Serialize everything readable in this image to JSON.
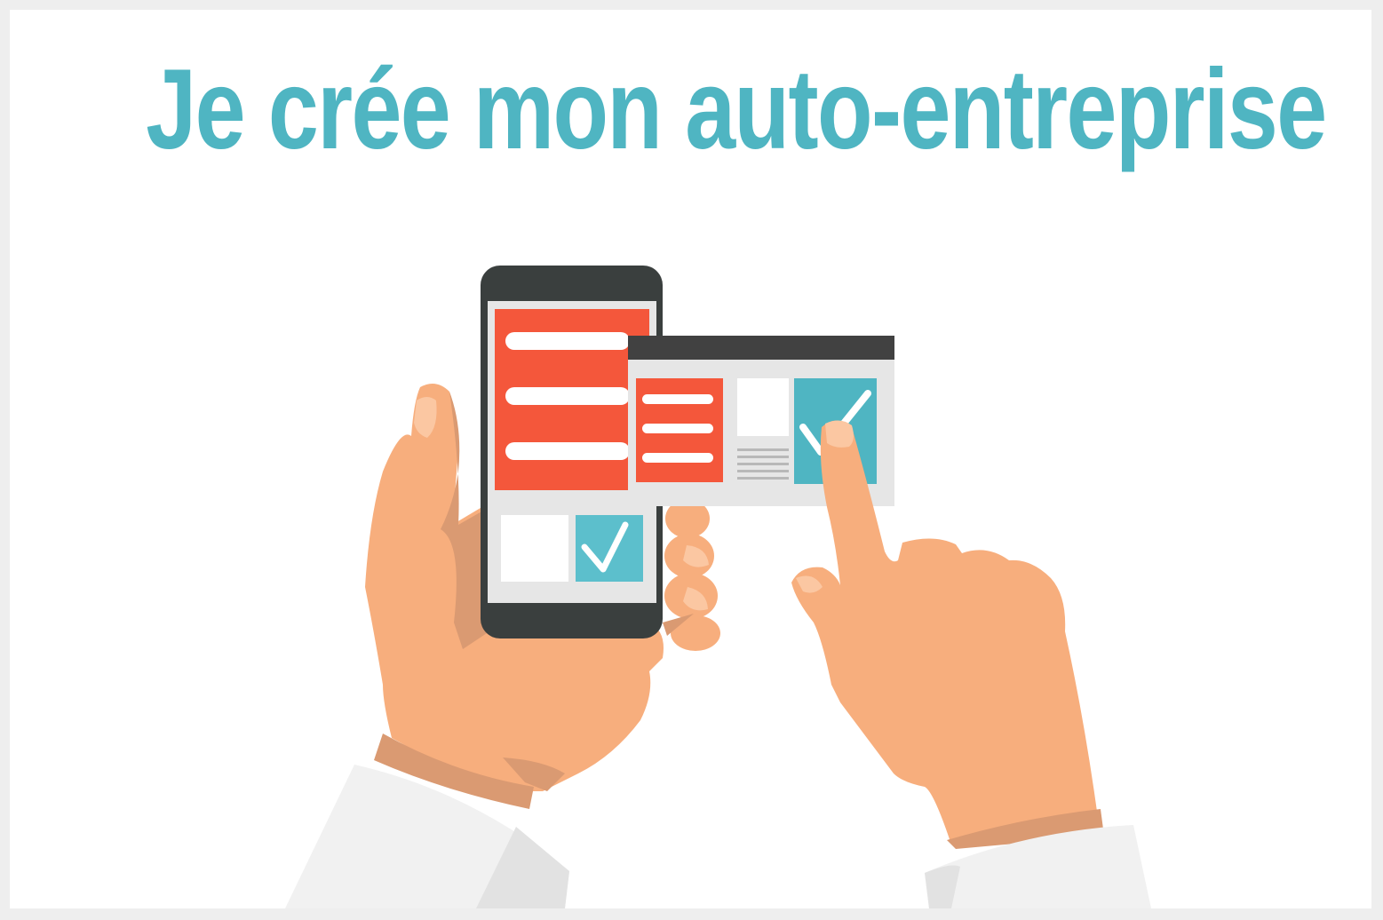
{
  "title": "Je crée mon auto-entreprise",
  "colors": {
    "background": "#ffffff",
    "border": "#eeeeee",
    "title": "#4fb5c2",
    "accent_red": "#f4573b",
    "accent_teal": "#4fb5c2",
    "skin": "#f7ae7d",
    "skin_shadow": "#da9a72",
    "phone_body": "#3a3f3e",
    "sleeve": "#f1f1f1"
  },
  "icons": [
    "smartphone-icon",
    "browser-window-icon",
    "checkbox-checked-icon",
    "hand-holding-icon",
    "pointing-hand-icon"
  ]
}
